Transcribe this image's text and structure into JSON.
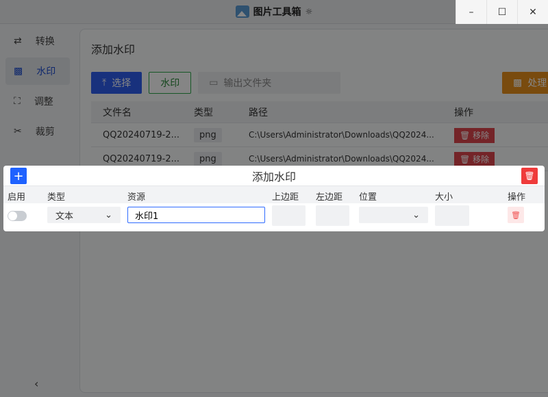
{
  "app": {
    "title": "图片工具箱",
    "theme_icon": "sun-icon"
  },
  "window": {
    "minimize": "–",
    "maximize": "☐",
    "close": "✕"
  },
  "sidebar": {
    "items": [
      {
        "label": "转换",
        "icon": "⇄"
      },
      {
        "label": "水印",
        "icon": "▩"
      },
      {
        "label": "调整",
        "icon": "⛶"
      },
      {
        "label": "裁剪",
        "icon": "✂"
      }
    ],
    "active": "水印",
    "collapse": "‹"
  },
  "main": {
    "title": "添加水印",
    "select_label": "选择",
    "watermark_label": "水印",
    "output_placeholder": "输出文件夹",
    "process_label": "处理"
  },
  "table": {
    "headers": [
      "文件名",
      "类型",
      "路径",
      "操作"
    ],
    "rows": [
      {
        "name": "QQ20240719-2...",
        "type": "png",
        "path": "C:\\Users\\Administrator\\Downloads\\QQ2024...",
        "action": "移除"
      },
      {
        "name": "QQ20240719-2...",
        "type": "png",
        "path": "C:\\Users\\Administrator\\Downloads\\QQ2024...",
        "action": "移除"
      }
    ]
  },
  "dialog": {
    "title": "添加水印",
    "add": "+",
    "headers": [
      "启用",
      "类型",
      "资源",
      "上边距",
      "左边距",
      "位置",
      "大小",
      "操作"
    ],
    "row": {
      "enabled": false,
      "type": "文本",
      "resource": "水印1",
      "top": "",
      "left": "",
      "position": "",
      "size": ""
    }
  },
  "colors": {
    "primary": "#1f62ff",
    "danger": "#ef3b3b",
    "success": "#2aa84a",
    "warning": "#e8901a"
  }
}
